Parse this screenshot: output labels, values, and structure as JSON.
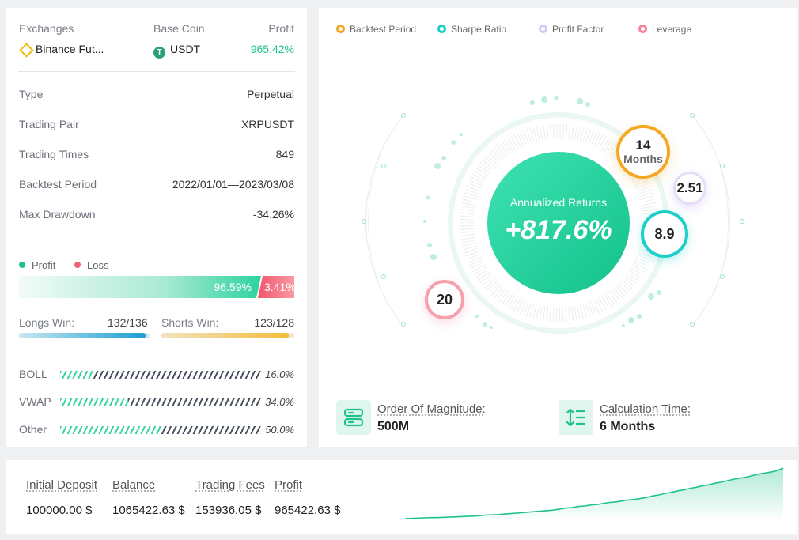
{
  "summary": {
    "exchanges_label": "Exchanges",
    "base_coin_label": "Base Coin",
    "profit_label": "Profit",
    "exchange_value": "Binance Fut...",
    "exchange_icon": "binance-icon",
    "base_coin_value": "USDT",
    "base_coin_icon": "tether-icon",
    "profit_value": "965.42%"
  },
  "details": [
    {
      "label": "Type",
      "value": "Perpetual"
    },
    {
      "label": "Trading Pair",
      "value": "XRPUSDT"
    },
    {
      "label": "Trading Times",
      "value": "849"
    },
    {
      "label": "Backtest Period",
      "value": "2022/01/01—2023/03/08"
    },
    {
      "label": "Max Drawdown",
      "value": "-34.26%"
    }
  ],
  "profit_loss": {
    "profit_legend": "Profit",
    "loss_legend": "Loss",
    "profit_pct": "96.59%",
    "loss_pct": "3.41%",
    "profit_fraction": 0.9659,
    "colors": {
      "profit": "#1ec28b",
      "loss": "#ec6473"
    }
  },
  "wins": {
    "longs_label": "Longs Win:",
    "longs_value": "132/136",
    "longs_fraction": 0.97,
    "shorts_label": "Shorts Win:",
    "shorts_value": "123/128",
    "shorts_fraction": 0.96,
    "colors": {
      "longs": "#1a9ed0",
      "shorts": "#f2bd3c"
    }
  },
  "indicators": [
    {
      "label": "BOLL",
      "pct": "16.0%",
      "fraction": 0.16
    },
    {
      "label": "VWAP",
      "pct": "34.0%",
      "fraction": 0.34
    },
    {
      "label": "Other",
      "pct": "50.0%",
      "fraction": 0.5
    }
  ],
  "legend": [
    {
      "label": "Backtest Period",
      "color": "#f5a623"
    },
    {
      "label": "Sharpe Ratio",
      "color": "#1ecfc9"
    },
    {
      "label": "Profit Factor",
      "color": "#d8c8f5"
    },
    {
      "label": "Leverage",
      "color": "#f3869a"
    }
  ],
  "center": {
    "title": "Annualized Returns",
    "value": "+817.6%"
  },
  "bubbles": {
    "backtest_value": "14",
    "backtest_unit": "Months",
    "profit_factor": "2.51",
    "sharpe_ratio": "8.9",
    "leverage": "20"
  },
  "stats": {
    "magnitude_label": "Order Of Magnitude:",
    "magnitude_value": "500M",
    "magnitude_icon": "server-icon",
    "calc_label": "Calculation Time:",
    "calc_value": "6 Months",
    "calc_icon": "sort-lines-icon"
  },
  "bottom": {
    "initial_deposit_label": "Initial Deposit",
    "initial_deposit_value": "100000.00 $",
    "balance_label": "Balance",
    "balance_value": "1065422.63 $",
    "fees_label": "Trading Fees",
    "fees_value": "153936.05 $",
    "profit_label": "Profit",
    "profit_value": "965422.63 $"
  },
  "chart_data": {
    "type": "area",
    "title": "",
    "xlabel": "",
    "ylabel": "",
    "color": "#1ec28b",
    "values": [
      0,
      0.5,
      1,
      1.5,
      2,
      2,
      2.5,
      3,
      3.5,
      4,
      4.5,
      5,
      6,
      7,
      7.5,
      8,
      9,
      10,
      11,
      12,
      13,
      14,
      15,
      16,
      17,
      19,
      21,
      22,
      24,
      25,
      27,
      28,
      30,
      32,
      33,
      35,
      37,
      38,
      40,
      42,
      45,
      47,
      50,
      52,
      55,
      57,
      60,
      62,
      65,
      67,
      70,
      72,
      75,
      78,
      80,
      82,
      85,
      88,
      90,
      92,
      95,
      100
    ]
  }
}
